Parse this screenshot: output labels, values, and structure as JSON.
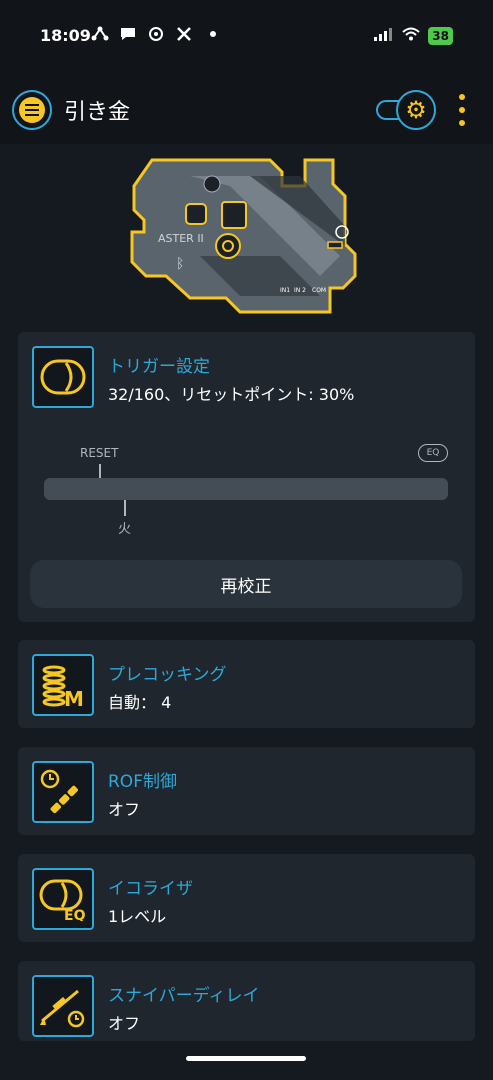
{
  "status_bar": {
    "time": "18:09",
    "battery": "38",
    "left_icons": [
      "network-icon",
      "chat-icon",
      "threads-icon",
      "x-icon"
    ],
    "right_icons": [
      "signal-icon",
      "wifi-icon",
      "battery-icon"
    ]
  },
  "header": {
    "title": "引き金",
    "menu_icon": "hamburger-icon",
    "toggle_icon": "gear-icon",
    "more_icon": "kebab-icon"
  },
  "board": {
    "brand": "ASTER II",
    "labels": [
      "IN1",
      "IN 2",
      "COM"
    ]
  },
  "trigger": {
    "title": "トリガー設定",
    "value": "32/160、リセットポイント: 30%",
    "reset_label": "RESET",
    "eq_label": "EQ",
    "fire_label": "火",
    "recalibrate_label": "再校正"
  },
  "precocking": {
    "title": "プレコッキング",
    "value": "自動： 4"
  },
  "rof": {
    "title": "ROF制御",
    "value": "オフ"
  },
  "equalizer": {
    "title": "イコライザ",
    "value": "1レベル"
  },
  "sniper": {
    "title": "スナイパーディレイ",
    "value": "オフ"
  },
  "colors": {
    "accent": "#2ea8d8",
    "yellow": "#f6c623",
    "card_bg": "#1f262e",
    "background": "#141a20"
  }
}
